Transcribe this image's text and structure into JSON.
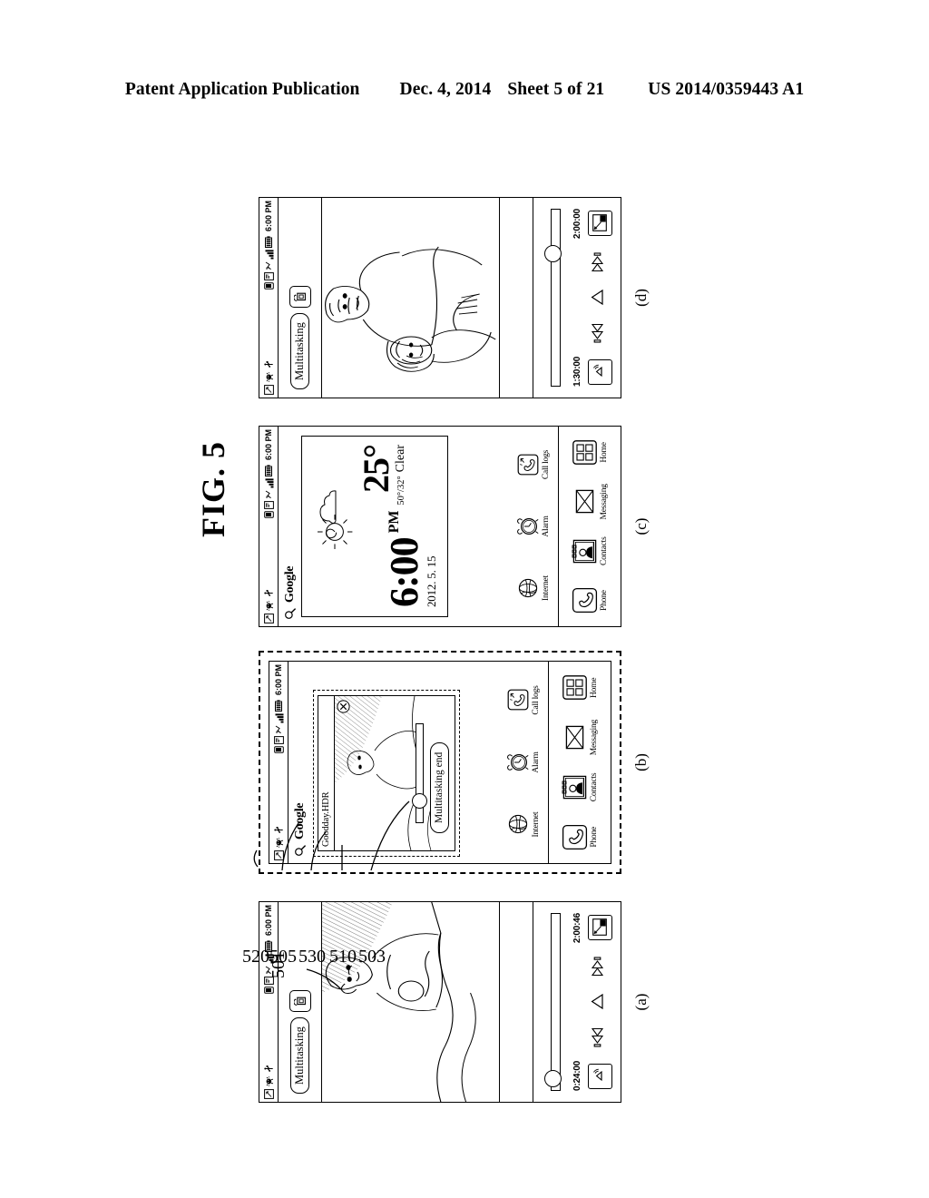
{
  "header": {
    "publication": "Patent Application Publication",
    "date": "Dec. 4, 2014",
    "sheet": "Sheet 5 of 21",
    "number": "US 2014/0359443 A1"
  },
  "figure": {
    "title": "FIG. 5"
  },
  "status_bar": {
    "time": "6:00 PM",
    "left_icons": [
      "screenshot-icon",
      "android-robot-icon",
      "usb-icon"
    ],
    "right_icons": [
      "device-icon",
      "sd-card-icon",
      "sync-icon",
      "signal-icon",
      "battery-icon"
    ]
  },
  "panels": [
    {
      "letter": "(a)",
      "type": "video-player",
      "ref": "501",
      "multitask_label": "Multitasking",
      "rotate_icon": "screen-rotate-icon",
      "time_current": "0:24:00",
      "time_total": "2:00:46",
      "seek_percent": 6,
      "controls": [
        "sound-icon",
        "previous-track-icon",
        "play-icon",
        "next-track-icon",
        "screen-mode-icon"
      ]
    },
    {
      "letter": "(b)",
      "type": "home-with-floating-video",
      "refs": [
        "503",
        "510",
        "530",
        "505",
        "520"
      ],
      "search_label": "Google",
      "float_window": {
        "title": "Goodday.HDR",
        "end_button": "Multitasking end",
        "close_icon": "close-icon",
        "seek_percent": 32
      }
    },
    {
      "letter": "(c)",
      "type": "home",
      "search_label": "Google",
      "widget": {
        "time": "6:00",
        "ampm": "PM",
        "date": "2012. 5. 15",
        "temp": "25°",
        "hi_lo": "50°/32°",
        "condition": "Clear",
        "weather_icon": "sun-cloud-icon"
      }
    },
    {
      "letter": "(d)",
      "type": "video-player",
      "multitask_label": "Multitasking",
      "rotate_icon": "screen-rotate-icon",
      "time_current": "1:30:00",
      "time_total": "2:00:00",
      "seek_percent": 74,
      "controls": [
        "sound-icon",
        "previous-track-icon",
        "play-icon",
        "next-track-icon",
        "screen-mode-icon"
      ]
    }
  ],
  "apps": {
    "row": [
      {
        "label": "Internet",
        "icon": "internet-globe-icon"
      },
      {
        "label": "Alarm",
        "icon": "alarm-clock-icon"
      },
      {
        "label": "Call logs",
        "icon": "call-logs-icon"
      }
    ],
    "dock": [
      {
        "label": "Phone",
        "icon": "phone-handset-icon"
      },
      {
        "label": "Contacts",
        "icon": "contacts-icon"
      },
      {
        "label": "Messaging",
        "icon": "envelope-icon"
      },
      {
        "label": "Home",
        "icon": "app-grid-icon"
      }
    ]
  }
}
